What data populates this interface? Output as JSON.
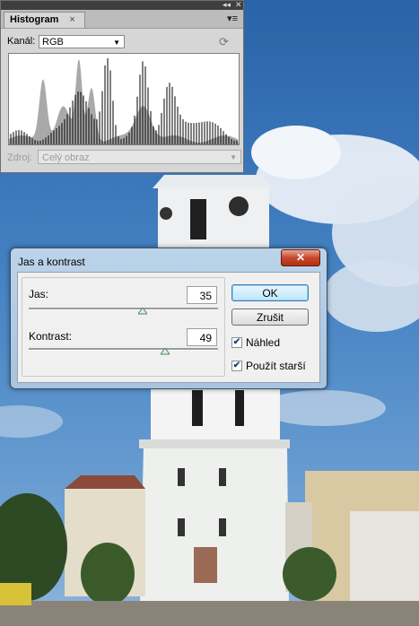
{
  "histogram_panel": {
    "tab_label": "Histogram",
    "close_glyph": "×",
    "collapse_glyph": "◂◂",
    "close_panel_glyph": "✕",
    "menu_glyph": "▾≡",
    "channel_label": "Kanál:",
    "channel_value": "RGB",
    "refresh_icon": "refresh-icon",
    "source_label": "Zdroj:",
    "source_value": "Celý obraz"
  },
  "dialog": {
    "title": "Jas a kontrast",
    "close_glyph": "✕",
    "brightness_label": "Jas:",
    "brightness_value": "35",
    "brightness_level": 0.6,
    "contrast_label": "Kontrast:",
    "contrast_value": "49",
    "contrast_level": 0.72,
    "ok_label": "OK",
    "cancel_label": "Zrušit",
    "preview_label": "Náhled",
    "preview_checked": true,
    "legacy_label": "Použít starší",
    "legacy_checked": true
  },
  "colors": {
    "dialog_frame": "#a8c3de",
    "close_button": "#c7472c",
    "ok_button_border": "#3c7fb1"
  }
}
